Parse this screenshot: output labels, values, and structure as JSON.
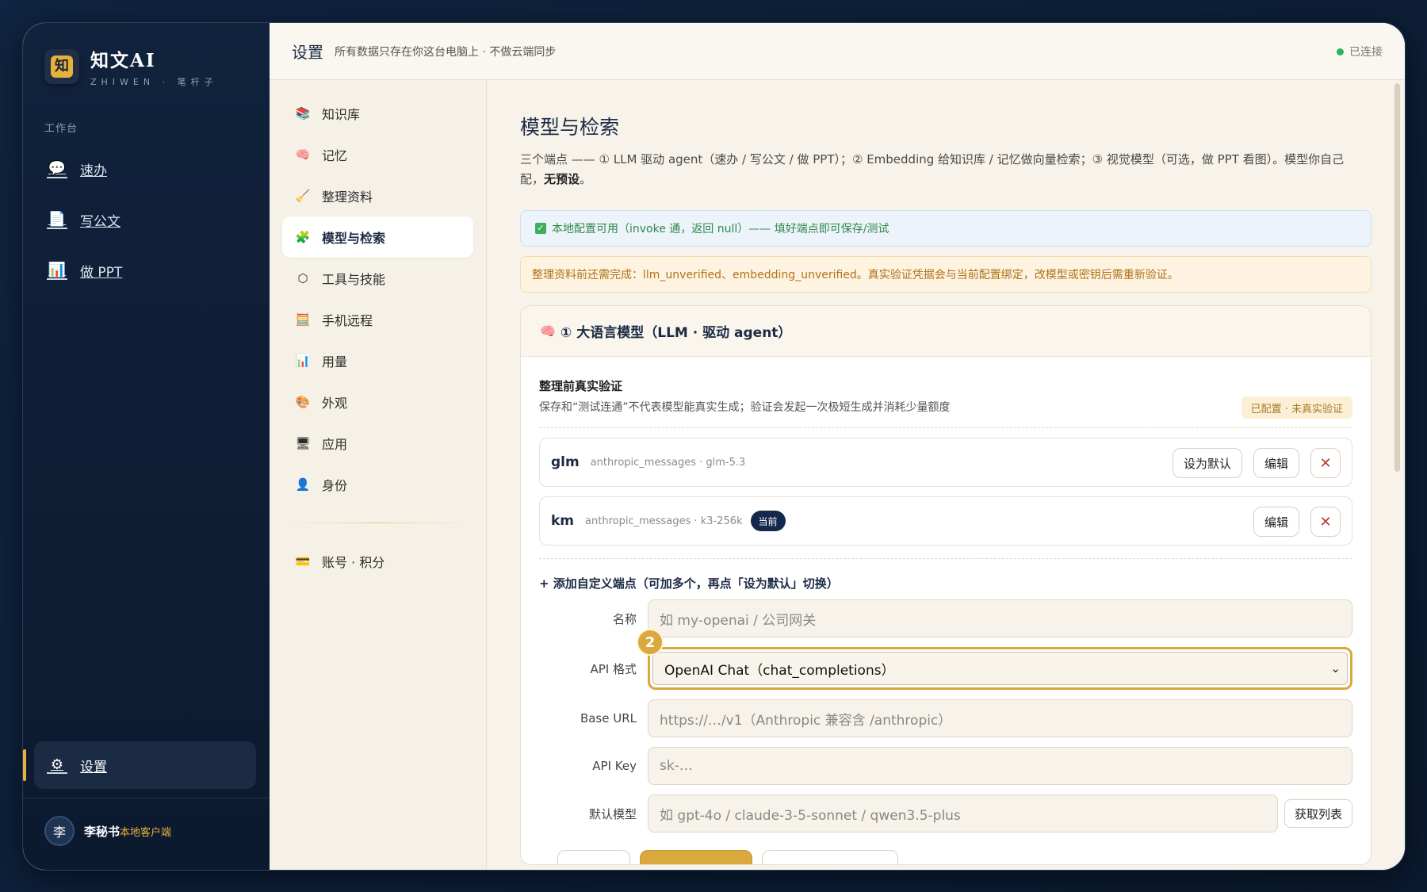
{
  "brand": {
    "logo_char": "知",
    "name": "知文AI",
    "sub": "ZHIWEN · 笔杆子"
  },
  "sidebar": {
    "section_label": "工作台",
    "items": [
      {
        "label": "速办",
        "icon": "speech-bubble-icon"
      },
      {
        "label": "写公文",
        "icon": "document-icon"
      },
      {
        "label": "做 PPT",
        "icon": "bar-chart-icon"
      }
    ],
    "settings": {
      "label": "设置",
      "icon": "gear-icon"
    },
    "user": {
      "avatar": "李",
      "name": "李秘书",
      "tag": "本地客户端"
    }
  },
  "topbar": {
    "title": "设置",
    "subtitle": "所有数据只存在你这台电脑上 · 不做云端同步",
    "status": "已连接",
    "status_color": "#2fb35a"
  },
  "menu": {
    "items": [
      {
        "label": "知识库",
        "icon": "books-icon"
      },
      {
        "label": "记忆",
        "icon": "brain-icon"
      },
      {
        "label": "整理资料",
        "icon": "broom-icon"
      },
      {
        "label": "模型与检索",
        "icon": "puzzle-icon",
        "active": true
      },
      {
        "label": "工具与技能",
        "icon": "hexagon-icon"
      },
      {
        "label": "手机远程",
        "icon": "calculator-icon"
      },
      {
        "label": "用量",
        "icon": "bar-chart-icon"
      },
      {
        "label": "外观",
        "icon": "palette-icon"
      },
      {
        "label": "应用",
        "icon": "monitor-icon"
      },
      {
        "label": "身份",
        "icon": "person-icon"
      }
    ],
    "account": {
      "label": "账号 · 积分",
      "icon": "credit-card-icon"
    }
  },
  "content": {
    "title": "模型与检索",
    "desc_main": "三个端点 —— ① LLM 驱动 agent（速办 / 写公文 / 做 PPT）；② Embedding 给知识库 / 记忆做向量检索；③ 视觉模型（可选，做 PPT 看图）。模型你自己配，",
    "desc_bold": "无预设",
    "desc_end": "。",
    "info_ok": "本地配置可用（invoke 通，返回 null）—— 填好端点即可保存/测试",
    "info_warn": "整理资料前还需完成：llm_unverified、embedding_unverified。真实验证凭据会与当前配置绑定，改模型或密钥后需重新验证。",
    "card": {
      "title": "① 大语言模型（LLM · 驱动 agent）",
      "title_icon": "brain-icon",
      "verify_title": "整理前真实验证",
      "verify_sub": "保存和“测试连通”不代表模型能真实生成；验证会发起一次极短生成并消耗少量额度",
      "verify_badge": "已配置 · 未真实验证",
      "endpoints": [
        {
          "name": "glm",
          "meta": "anthropic_messages · glm-5.3",
          "current": false,
          "set_default": "设为默认",
          "edit": "编辑"
        },
        {
          "name": "km",
          "meta": "anthropic_messages · k3-256k",
          "current": true,
          "current_label": "当前",
          "edit": "编辑"
        }
      ],
      "add_link": "+ 添加自定义端点（可加多个，再点「设为默认」切换）",
      "form": {
        "name_label": "名称",
        "name_placeholder": "如 my-openai / 公司网关",
        "api_label": "API 格式",
        "api_value": "OpenAI Chat（chat_completions）",
        "step": "2",
        "base_label": "Base URL",
        "base_placeholder": "https://…/v1（Anthropic 兼容含 /anthropic）",
        "key_label": "API Key",
        "key_placeholder": "sk-…",
        "model_label": "默认模型",
        "model_placeholder": "如 gpt-4o / claude-3-5-sonnet / qwen3.5-plus",
        "fetch_label": "获取列表"
      }
    }
  }
}
